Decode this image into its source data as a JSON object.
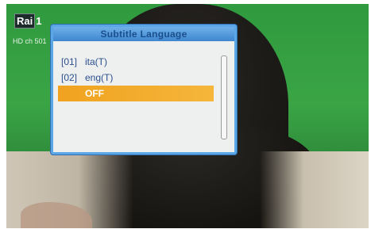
{
  "channel": {
    "logo_text": "Rai",
    "logo_number": "1",
    "info": "HD ch 501"
  },
  "dialog": {
    "title": "Subtitle Language",
    "items": [
      {
        "index": "[01]",
        "label": "ita(T)"
      },
      {
        "index": "[02]",
        "label": "eng(T)"
      },
      {
        "index": "",
        "label": "OFF"
      }
    ],
    "selected_label": "OFF"
  },
  "colors": {
    "accent_selection": "#f0a21f",
    "title_bar": "#3e86cf",
    "list_text": "#2b4f8e"
  }
}
